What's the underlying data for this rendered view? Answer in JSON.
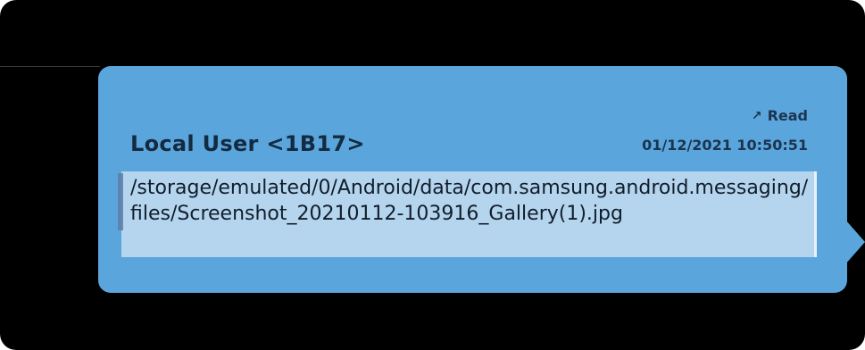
{
  "message": {
    "status_icon": "arrow-up-right-icon",
    "status_label": "Read",
    "sender": "Local User <1B17>",
    "timestamp": "01/12/2021 10:50:51",
    "body": "/storage/emulated/0/Android/data/com.samsung.android.messaging/files/Screenshot_20210112-103916_Gallery(1).jpg"
  },
  "colors": {
    "bubble": "#5aa6dc",
    "text_box": "#b5d5ee",
    "background": "#000000"
  }
}
